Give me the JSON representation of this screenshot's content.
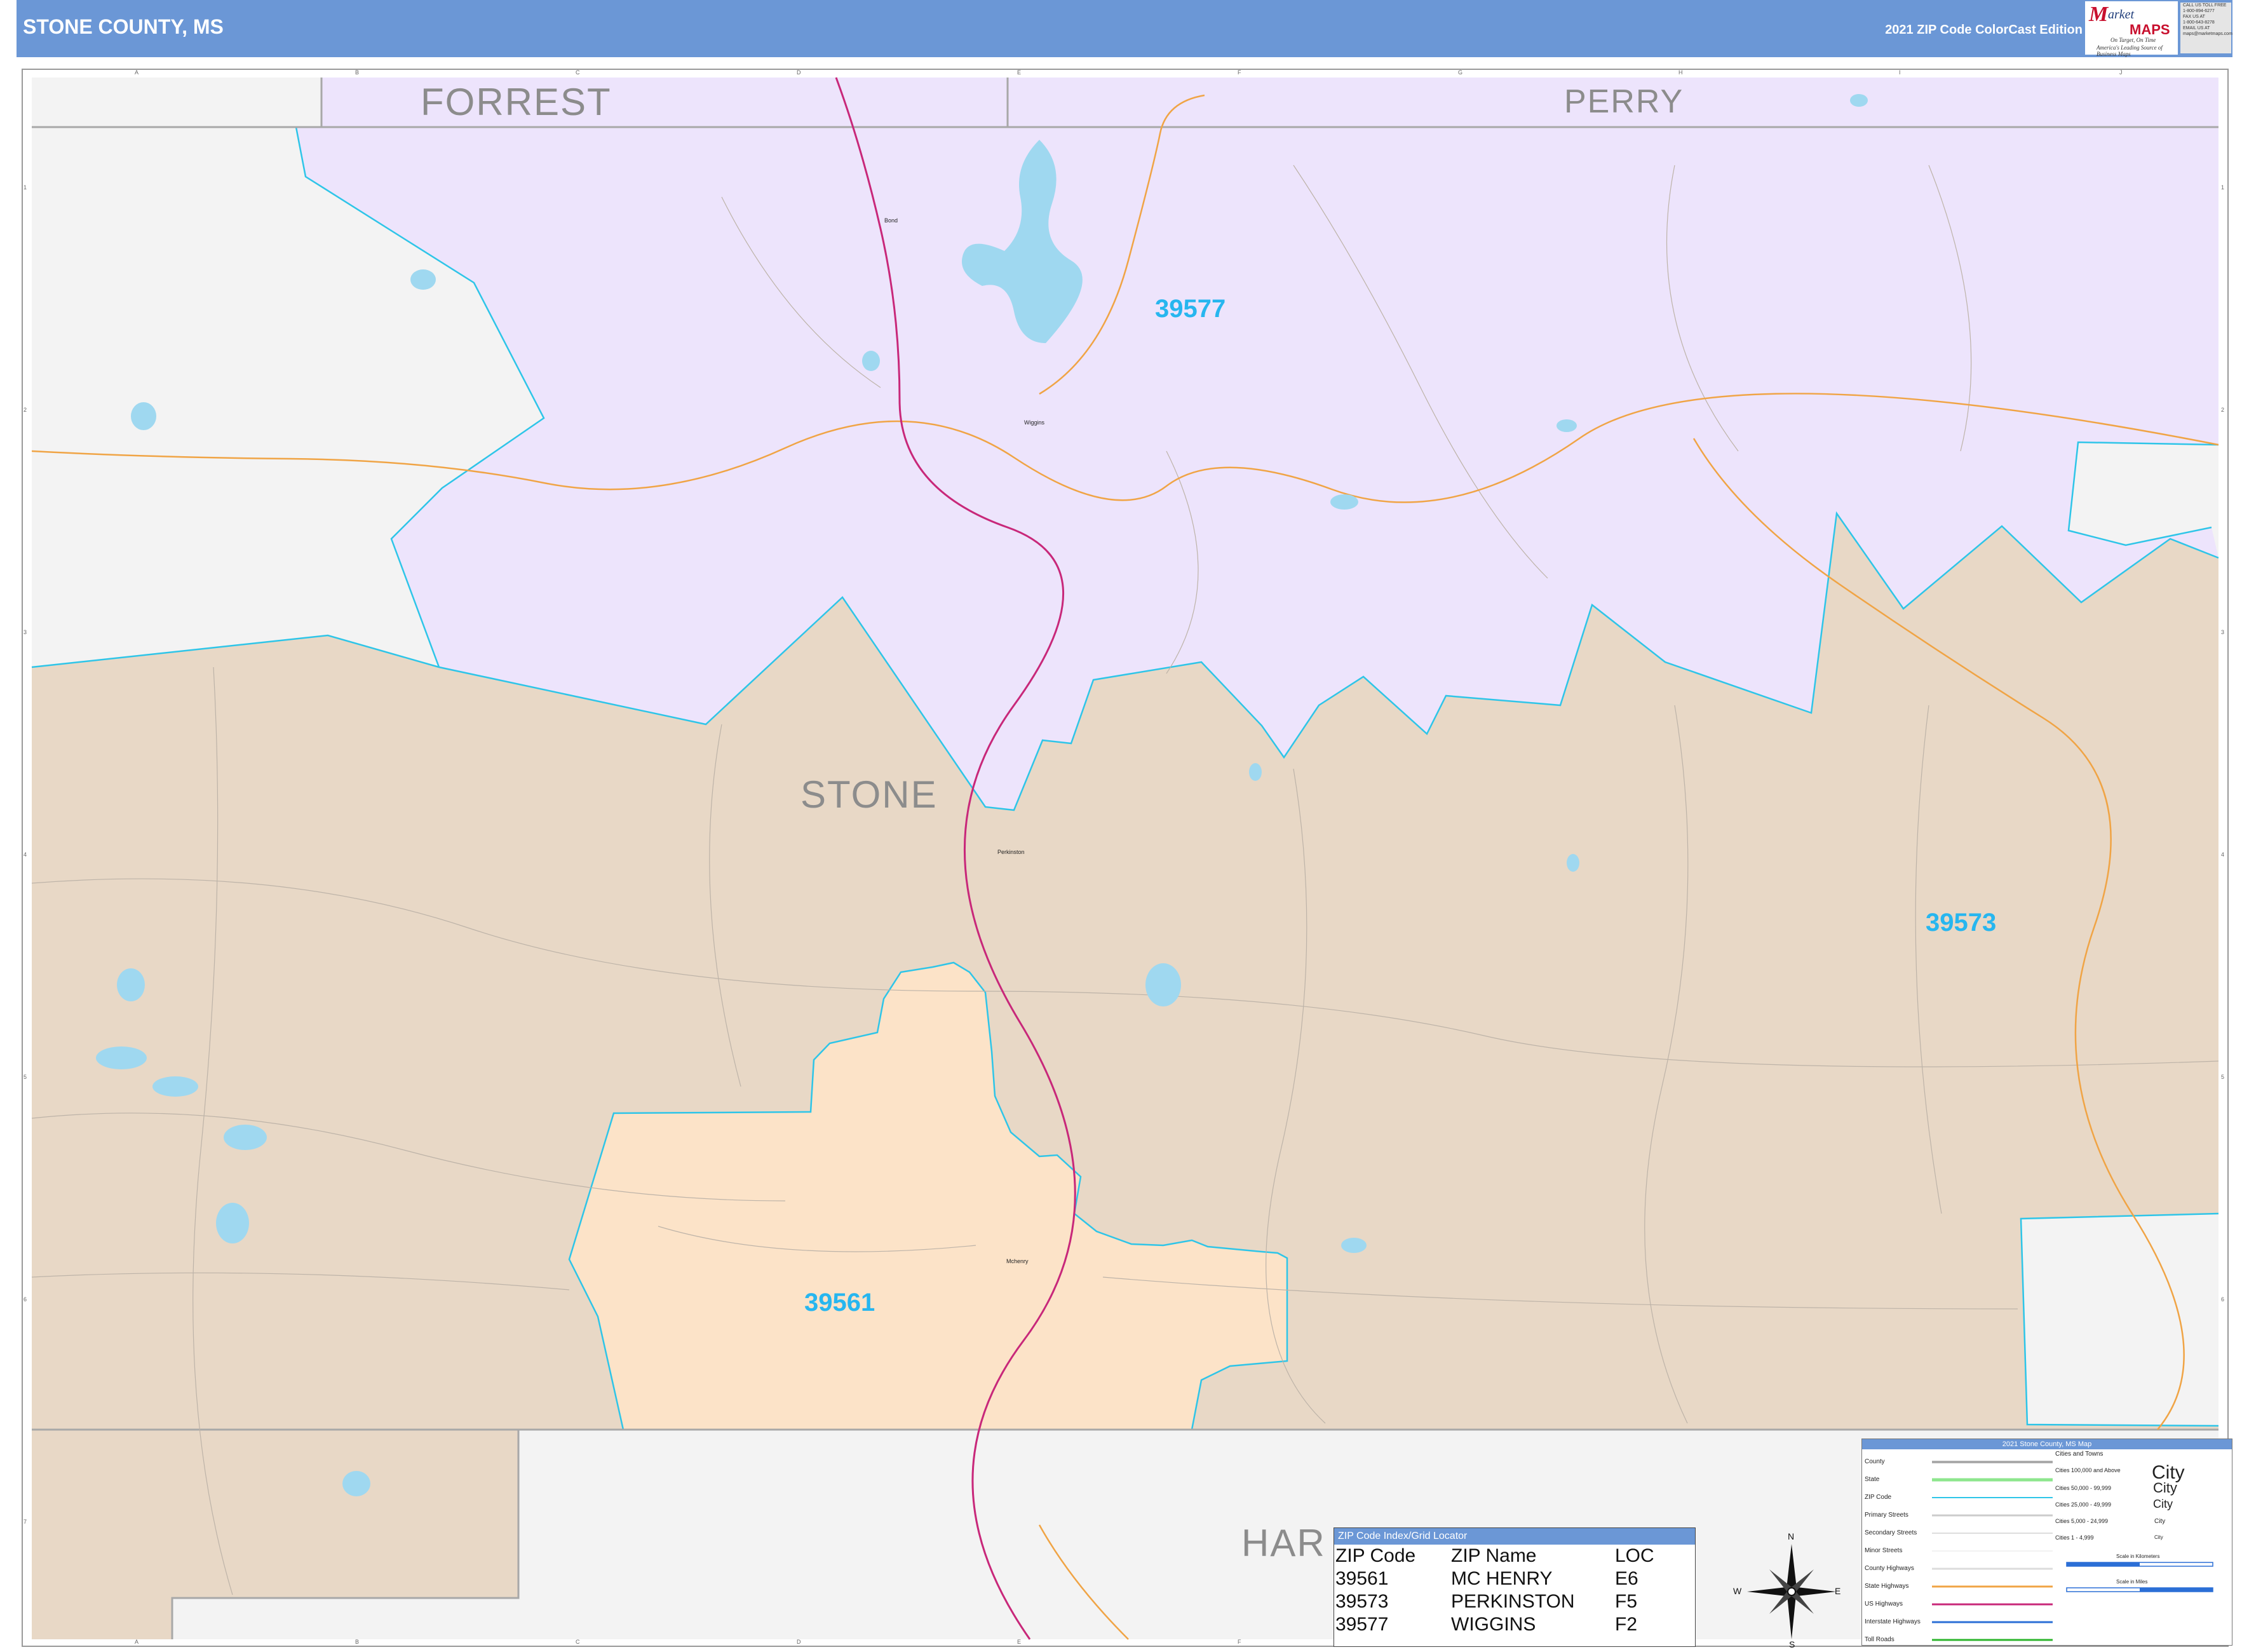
{
  "header": {
    "title": "STONE COUNTY, MS",
    "edition": "2021 ZIP Code ColorCast Edition"
  },
  "logo": {
    "mark": "M",
    "word1": "arket",
    "word2": "MAPS",
    "tagline1": "On Target, On Time",
    "tagline2": "America's Leading Source of Business Maps"
  },
  "contact_lines": [
    "CALL US TOLL FREE",
    "1-800-894-6277",
    "FAX US AT",
    "1-800-643-8278",
    "EMAIL US AT",
    "maps@marketmaps.com"
  ],
  "grid": {
    "letters": [
      "A",
      "B",
      "C",
      "D",
      "E",
      "F",
      "G",
      "H",
      "I",
      "J"
    ],
    "numbers": [
      "1",
      "2",
      "3",
      "4",
      "5",
      "6",
      "7"
    ]
  },
  "map": {
    "counties": [
      "FORREST",
      "PERRY",
      "STONE",
      "HAR"
    ],
    "zips": [
      {
        "code": "39577",
        "color": "#ede4fc"
      },
      {
        "code": "39573",
        "color": "#e8d8c6"
      },
      {
        "code": "39561",
        "color": "#fce3c8"
      }
    ],
    "towns": [
      "Bond",
      "Wiggins",
      "Perkinston",
      "Mchenry"
    ],
    "outside_color": "#f3f3f3",
    "zip_boundary_color": "#2ec5e8",
    "interstate_color": "#c8287a",
    "highway_color": "#f0a445",
    "water_color": "#9fd8f0"
  },
  "zip_index": {
    "title": "ZIP Code Index/Grid Locator",
    "headers": [
      "ZIP Code",
      "ZIP Name",
      "LOC"
    ],
    "rows": [
      [
        "39561",
        "MC HENRY",
        "E6"
      ],
      [
        "39573",
        "PERKINSTON",
        "F5"
      ],
      [
        "39577",
        "WIGGINS",
        "F2"
      ]
    ]
  },
  "legend": {
    "title": "2021 Stone County, MS Map",
    "items": [
      "County",
      "State",
      "ZIP Code",
      "Primary Streets",
      "Secondary Streets",
      "Minor Streets",
      "County Highways",
      "State Highways",
      "US Highways",
      "Interstate Highways",
      "Toll Roads"
    ],
    "cities_title": "Cities and Towns",
    "cities": [
      "Cities 100,000 and Above",
      "Cities 50,000 - 99,999",
      "Cities 25,000 - 49,999",
      "Cities 5,000 - 24,999",
      "Cities 1 - 4,999"
    ],
    "city_samples": [
      "City",
      "City",
      "City",
      "City",
      "City"
    ],
    "scale_km": "Scale in Kilometers",
    "scale_mi": "Scale in Miles"
  },
  "compass": {
    "n": "N",
    "s": "S",
    "e": "E",
    "w": "W"
  }
}
